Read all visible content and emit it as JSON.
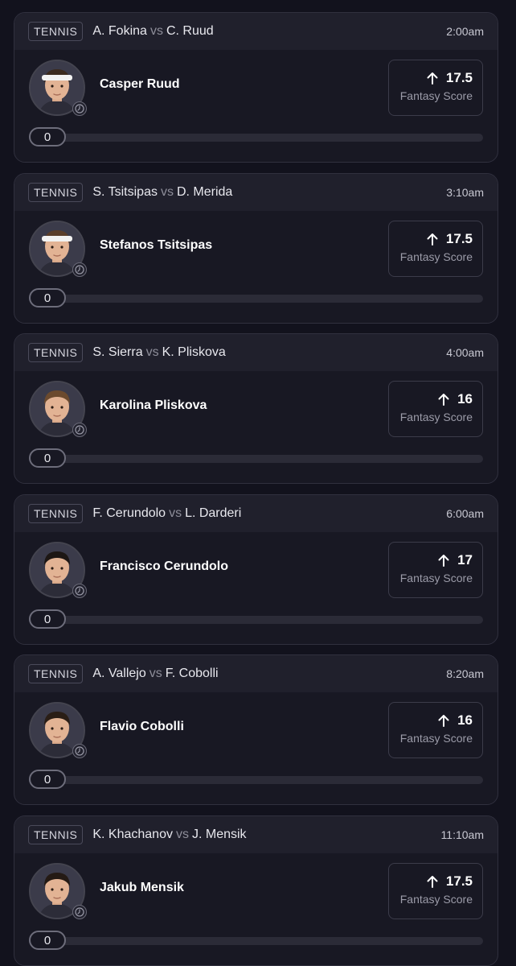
{
  "cards": [
    {
      "sport": "TENNIS",
      "player1": "A. Fokina",
      "vs": "vs",
      "player2": "C. Ruud",
      "time": "2:00am",
      "player_name": "Casper Ruud",
      "score": "17.5",
      "score_label": "Fantasy Score",
      "progress_value": "0",
      "progress_fraction": 0,
      "headwear": "headband",
      "hair": "#3b2a1e"
    },
    {
      "sport": "TENNIS",
      "player1": "S. Tsitsipas",
      "vs": "vs",
      "player2": "D. Merida",
      "time": "3:10am",
      "player_name": "Stefanos Tsitsipas",
      "score": "17.5",
      "score_label": "Fantasy Score",
      "progress_value": "0",
      "progress_fraction": 0,
      "headwear": "headband",
      "hair": "#5a3e2a"
    },
    {
      "sport": "TENNIS",
      "player1": "S. Sierra",
      "vs": "vs",
      "player2": "K. Pliskova",
      "time": "4:00am",
      "player_name": "Karolina Pliskova",
      "score": "16",
      "score_label": "Fantasy Score",
      "progress_value": "0",
      "progress_fraction": 0,
      "headwear": "none",
      "hair": "#6b4a2e"
    },
    {
      "sport": "TENNIS",
      "player1": "F. Cerundolo",
      "vs": "vs",
      "player2": "L. Darderi",
      "time": "6:00am",
      "player_name": "Francisco Cerundolo",
      "score": "17",
      "score_label": "Fantasy Score",
      "progress_value": "0",
      "progress_fraction": 0,
      "headwear": "none",
      "hair": "#1d1714"
    },
    {
      "sport": "TENNIS",
      "player1": "A. Vallejo",
      "vs": "vs",
      "player2": "F. Cobolli",
      "time": "8:20am",
      "player_name": "Flavio Cobolli",
      "score": "16",
      "score_label": "Fantasy Score",
      "progress_value": "0",
      "progress_fraction": 0,
      "headwear": "none",
      "hair": "#2a1e16"
    },
    {
      "sport": "TENNIS",
      "player1": "K. Khachanov",
      "vs": "vs",
      "player2": "J. Mensik",
      "time": "11:10am",
      "player_name": "Jakub Mensik",
      "score": "17.5",
      "score_label": "Fantasy Score",
      "progress_value": "0",
      "progress_fraction": 0,
      "headwear": "none",
      "hair": "#241a14"
    }
  ],
  "icons": {
    "score_arrow": "arrow-up-icon",
    "status": "clock-icon"
  },
  "colors": {
    "background": "#12121d",
    "card": "#181823",
    "header": "#20202c",
    "accent_text": "#ffffff"
  }
}
